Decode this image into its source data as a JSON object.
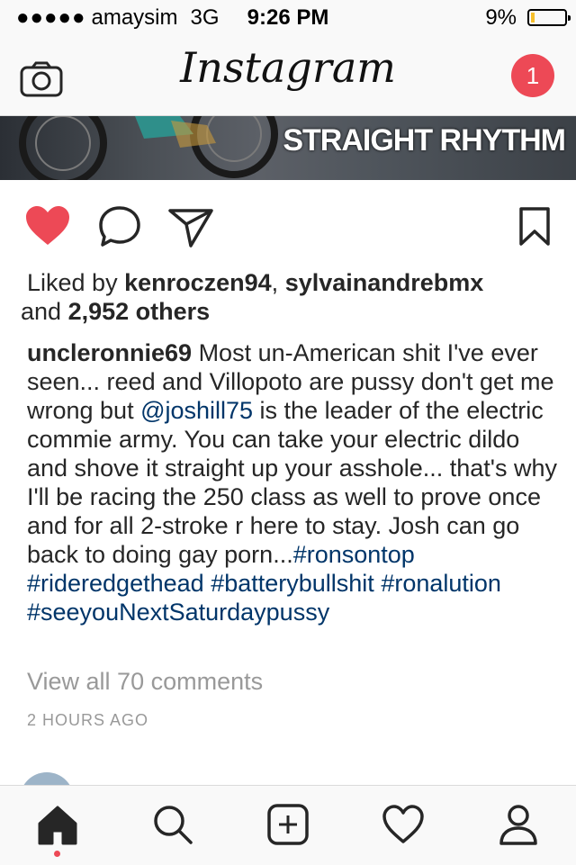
{
  "status": {
    "carrier": "amaysim",
    "network": "3G",
    "time": "9:26 PM",
    "battery": "9%",
    "battery_level": 0.09
  },
  "header": {
    "logo": "Instagram",
    "notification_count": "1"
  },
  "post": {
    "image_text": "STRAIGHT RHYTHM",
    "liked": true,
    "likes_prefix": "Liked by ",
    "liker1": "kenroczen94",
    "sep": ", ",
    "liker2": "sylvainandrebmx",
    "and": " and ",
    "others": "2,952 others",
    "caption_user": "uncleronnie69",
    "caption_text1": " Most  un-American  shit I've ever seen... reed and Villopoto are pussy don't get me wrong but ",
    "mention": "@joshill75",
    "caption_text2": " is the leader of the electric commie army.  You can take your electric dildo and shove it straight up your asshole... that's why I'll be racing the 250 class as well to prove once and for all 2-stroke r here to stay.  Josh can go back to doing gay porn...",
    "tag1": "#ronsontop",
    "tag2": "#rideredgethead",
    "tag3": "#batterybullshit",
    "tag4": "#ronalution",
    "tag5": "#seeyouNextSaturdaypussy",
    "view_all": "View all 70 comments",
    "time_ago": "2 HOURS AGO"
  },
  "colors": {
    "like_red": "#ed4956",
    "link_blue": "#003569"
  },
  "icons": [
    "camera-icon",
    "heart-icon",
    "comment-icon",
    "share-icon",
    "bookmark-icon",
    "home-icon",
    "search-icon",
    "add-icon",
    "activity-icon",
    "profile-icon"
  ]
}
